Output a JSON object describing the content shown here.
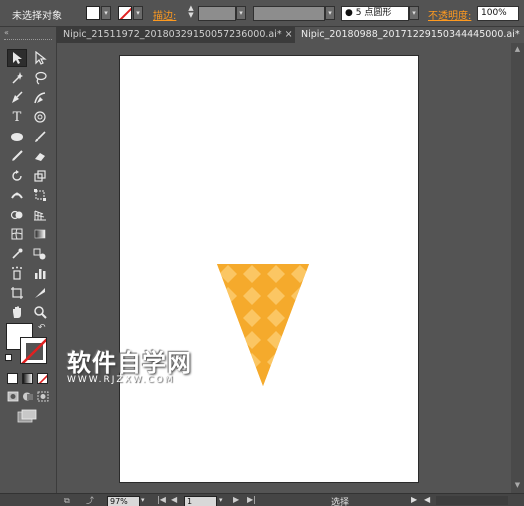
{
  "control_bar": {
    "selection_label": "未选择对象",
    "stroke_label": "描边:",
    "brush_label": "5 点圆形",
    "opacity_label": "不透明度:",
    "opacity_value": "100%"
  },
  "tabs": [
    {
      "label": "Nipic_21511972_20180329150057236000.ai* ×",
      "active": false
    },
    {
      "label": "Nipic_20180988_20171229150344445000.ai* ×",
      "active": true
    }
  ],
  "status_bar": {
    "zoom": "97%",
    "page": "1",
    "tool_label": "选择"
  },
  "watermark": {
    "main": "软件自学网",
    "url": "WWW.RJZXW.COM"
  },
  "colors": {
    "cone_fill": "#f5aa2c",
    "cone_pattern": "#fbc766",
    "accent_orange": "#ff9a1f"
  }
}
